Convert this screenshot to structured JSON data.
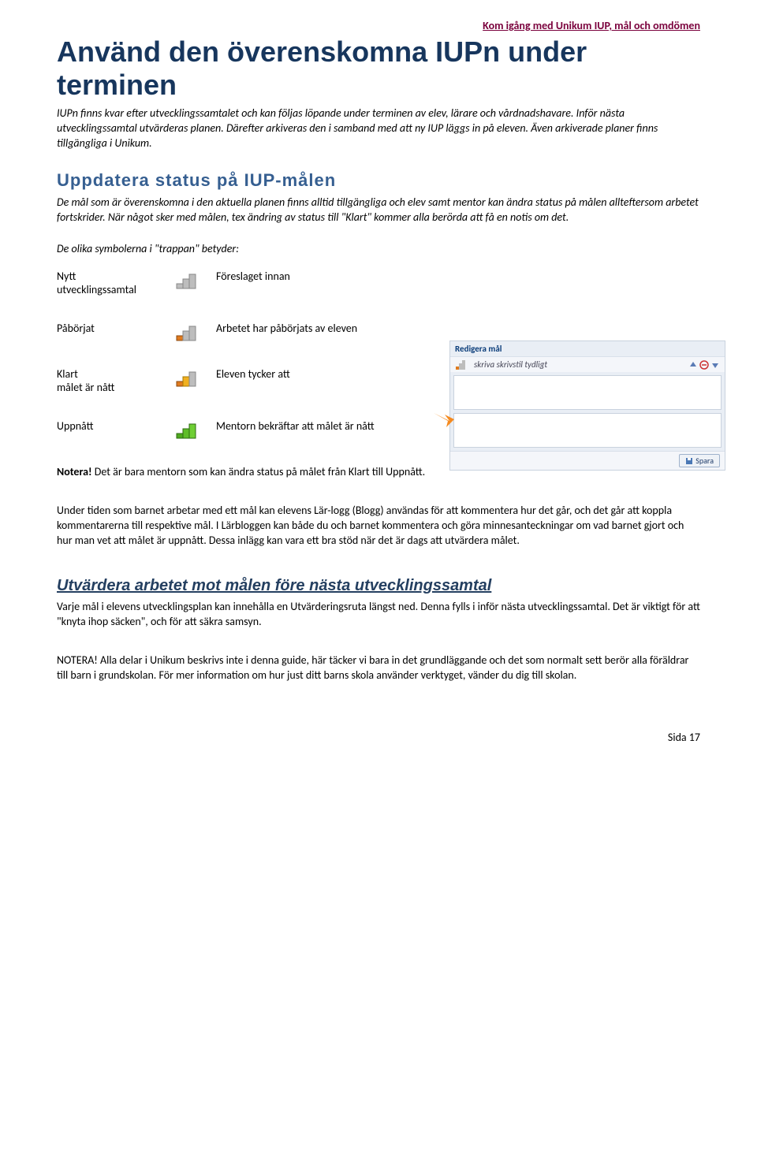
{
  "header": {
    "right": "Kom igång med Unikum IUP, mål och omdömen"
  },
  "title": "Använd den överenskomna IUPn under terminen",
  "intro": "IUPn finns kvar efter utvecklingssamtalet och kan följas löpande under terminen av elev, lärare och vårdnadshavare. Inför nästa utvecklingssamtal utvärderas planen. Därefter arkiveras den i samband med att ny IUP läggs in på eleven. Även arkiverade planer finns tillgängliga i Unikum.",
  "section1": {
    "heading": "Uppdatera status på IUP-målen",
    "body": "De mål som är överenskomna i den aktuella planen finns alltid tillgängliga och elev samt mentor kan ändra status på målen allteftersom arbetet fortskrider. När något sker med målen, tex ändring av status till \"Klart\" kommer alla berörda att få en notis om det.",
    "legend_intro": "De olika symbolerna i \"trappan\" betyder:"
  },
  "statuses": {
    "nytt": {
      "label": "Nytt",
      "sub": "utvecklingssamtal",
      "desc": "Föreslaget innan"
    },
    "paborjat": {
      "label": "Påbörjat",
      "desc": "Arbetet har påbörjats av eleven"
    },
    "klart": {
      "label": "Klart",
      "sub": "målet är nått",
      "desc": "Eleven tycker att"
    },
    "uppnatt": {
      "label": "Uppnått",
      "desc": "Mentorn bekräftar att målet är nått"
    }
  },
  "shot": {
    "title": "Redigera mål",
    "row": "skriva skrivstil tydligt",
    "save": "Spara"
  },
  "notera": {
    "bold": "Notera!",
    "text": " Det är bara mentorn som kan ändra status på målet från Klart till Uppnått."
  },
  "para1": "Under tiden som barnet arbetar med ett mål kan elevens Lär-logg (Blogg) användas för att kommentera hur det går, och det går att koppla kommentarerna till respektive mål. I Lärbloggen kan både du och barnet kommentera och göra minnesanteckningar om vad barnet gjort och hur man vet att målet är uppnått. Dessa inlägg kan vara ett bra stöd när det är dags att utvärdera målet.",
  "section2": {
    "heading": "Utvärdera arbetet mot målen före nästa utvecklingssamtal",
    "body": "Varje mål i elevens utvecklingsplan kan innehålla en Utvärderingsruta längst ned. Denna fylls i inför nästa utvecklingssamtal. Det är viktigt för att \"knyta ihop säcken\", och för att säkra samsyn."
  },
  "notera2": {
    "bold": "NOTERA!",
    "text": " Alla delar i Unikum beskrivs inte i denna guide, här täcker vi bara in det grundläggande och det som normalt sett berör alla föräldrar till barn i grundskolan. För mer information om hur just ditt barns skola använder verktyget, vänder du dig till skolan."
  },
  "footer": "Sida 17"
}
